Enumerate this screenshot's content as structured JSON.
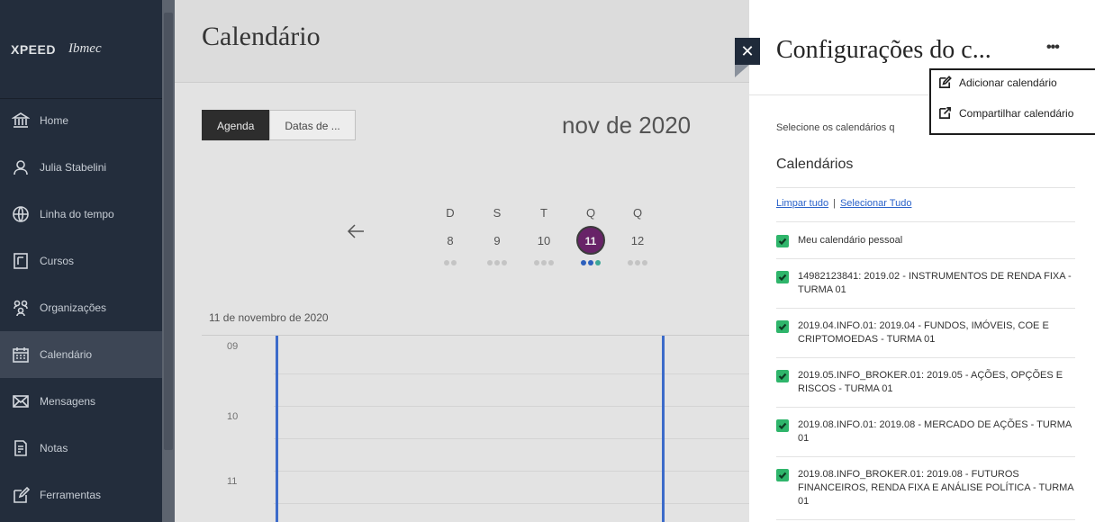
{
  "sidebar": {
    "brand_left": "XPEED",
    "brand_right": "Ibmec",
    "items": [
      {
        "label": "Home",
        "icon": "bank-icon"
      },
      {
        "label": "Julia Stabelini",
        "icon": "user-icon"
      },
      {
        "label": "Linha do tempo",
        "icon": "globe-icon"
      },
      {
        "label": "Cursos",
        "icon": "course-icon"
      },
      {
        "label": "Organizações",
        "icon": "organization-icon"
      },
      {
        "label": "Calendário",
        "icon": "calendar-icon",
        "active": true
      },
      {
        "label": "Mensagens",
        "icon": "envelope-icon"
      },
      {
        "label": "Notas",
        "icon": "grades-icon"
      },
      {
        "label": "Ferramentas",
        "icon": "tools-icon"
      }
    ]
  },
  "main": {
    "title": "Calendário",
    "tabs": [
      "Agenda",
      "Datas de ..."
    ],
    "month": "nov de 2020",
    "week": [
      {
        "letter": "D",
        "day": "8"
      },
      {
        "letter": "S",
        "day": "9"
      },
      {
        "letter": "T",
        "day": "10"
      },
      {
        "letter": "Q",
        "day": "11"
      },
      {
        "letter": "Q",
        "day": "12"
      }
    ],
    "selected_date": "11 de novembro de 2020",
    "hours": [
      "09",
      "10",
      "11"
    ]
  },
  "panel": {
    "title": "Configurações do c...",
    "intro": "Selecione os calendários q",
    "section_title": "Calendários",
    "clear_all": "Limpar tudo",
    "separator": "|",
    "select_all": "Selecionar Tudo",
    "calendars": [
      "Meu calendário pessoal",
      "14982123841: 2019.02 - INSTRUMENTOS DE RENDA FIXA - TURMA 01",
      "2019.04.INFO.01: 2019.04 - FUNDOS, IMÓVEIS, COE E CRIPTOMOEDAS - TURMA 01",
      "2019.05.INFO_BROKER.01: 2019.05 - AÇÕES, OPÇÕES E RISCOS - TURMA 01",
      "2019.08.INFO.01: 2019.08 - MERCADO DE AÇÕES - TURMA 01",
      "2019.08.INFO_BROKER.01: 2019.08 - FUTUROS FINANCEIROS, RENDA FIXA E ANÁLISE POLÍTICA - TURMA 01"
    ],
    "menu": {
      "add": "Adicionar calendário",
      "share": "Compartilhar calendário"
    }
  },
  "colors": {
    "sidebar_bg": "#1f2a3a",
    "today_circle": "#6b1f6b",
    "checkbox_green": "#2fb56b",
    "link_blue": "#2a62c9"
  }
}
